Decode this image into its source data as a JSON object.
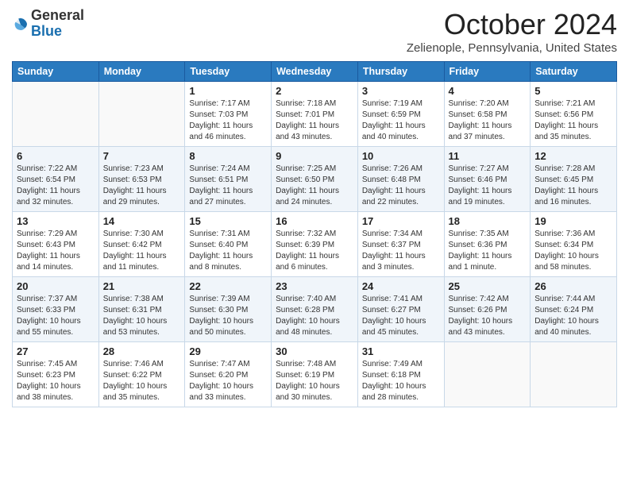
{
  "logo": {
    "general": "General",
    "blue": "Blue"
  },
  "header": {
    "month": "October 2024",
    "location": "Zelienople, Pennsylvania, United States"
  },
  "days_of_week": [
    "Sunday",
    "Monday",
    "Tuesday",
    "Wednesday",
    "Thursday",
    "Friday",
    "Saturday"
  ],
  "weeks": [
    [
      {
        "day": "",
        "info": ""
      },
      {
        "day": "",
        "info": ""
      },
      {
        "day": "1",
        "info": "Sunrise: 7:17 AM\nSunset: 7:03 PM\nDaylight: 11 hours and 46 minutes."
      },
      {
        "day": "2",
        "info": "Sunrise: 7:18 AM\nSunset: 7:01 PM\nDaylight: 11 hours and 43 minutes."
      },
      {
        "day": "3",
        "info": "Sunrise: 7:19 AM\nSunset: 6:59 PM\nDaylight: 11 hours and 40 minutes."
      },
      {
        "day": "4",
        "info": "Sunrise: 7:20 AM\nSunset: 6:58 PM\nDaylight: 11 hours and 37 minutes."
      },
      {
        "day": "5",
        "info": "Sunrise: 7:21 AM\nSunset: 6:56 PM\nDaylight: 11 hours and 35 minutes."
      }
    ],
    [
      {
        "day": "6",
        "info": "Sunrise: 7:22 AM\nSunset: 6:54 PM\nDaylight: 11 hours and 32 minutes."
      },
      {
        "day": "7",
        "info": "Sunrise: 7:23 AM\nSunset: 6:53 PM\nDaylight: 11 hours and 29 minutes."
      },
      {
        "day": "8",
        "info": "Sunrise: 7:24 AM\nSunset: 6:51 PM\nDaylight: 11 hours and 27 minutes."
      },
      {
        "day": "9",
        "info": "Sunrise: 7:25 AM\nSunset: 6:50 PM\nDaylight: 11 hours and 24 minutes."
      },
      {
        "day": "10",
        "info": "Sunrise: 7:26 AM\nSunset: 6:48 PM\nDaylight: 11 hours and 22 minutes."
      },
      {
        "day": "11",
        "info": "Sunrise: 7:27 AM\nSunset: 6:46 PM\nDaylight: 11 hours and 19 minutes."
      },
      {
        "day": "12",
        "info": "Sunrise: 7:28 AM\nSunset: 6:45 PM\nDaylight: 11 hours and 16 minutes."
      }
    ],
    [
      {
        "day": "13",
        "info": "Sunrise: 7:29 AM\nSunset: 6:43 PM\nDaylight: 11 hours and 14 minutes."
      },
      {
        "day": "14",
        "info": "Sunrise: 7:30 AM\nSunset: 6:42 PM\nDaylight: 11 hours and 11 minutes."
      },
      {
        "day": "15",
        "info": "Sunrise: 7:31 AM\nSunset: 6:40 PM\nDaylight: 11 hours and 8 minutes."
      },
      {
        "day": "16",
        "info": "Sunrise: 7:32 AM\nSunset: 6:39 PM\nDaylight: 11 hours and 6 minutes."
      },
      {
        "day": "17",
        "info": "Sunrise: 7:34 AM\nSunset: 6:37 PM\nDaylight: 11 hours and 3 minutes."
      },
      {
        "day": "18",
        "info": "Sunrise: 7:35 AM\nSunset: 6:36 PM\nDaylight: 11 hours and 1 minute."
      },
      {
        "day": "19",
        "info": "Sunrise: 7:36 AM\nSunset: 6:34 PM\nDaylight: 10 hours and 58 minutes."
      }
    ],
    [
      {
        "day": "20",
        "info": "Sunrise: 7:37 AM\nSunset: 6:33 PM\nDaylight: 10 hours and 55 minutes."
      },
      {
        "day": "21",
        "info": "Sunrise: 7:38 AM\nSunset: 6:31 PM\nDaylight: 10 hours and 53 minutes."
      },
      {
        "day": "22",
        "info": "Sunrise: 7:39 AM\nSunset: 6:30 PM\nDaylight: 10 hours and 50 minutes."
      },
      {
        "day": "23",
        "info": "Sunrise: 7:40 AM\nSunset: 6:28 PM\nDaylight: 10 hours and 48 minutes."
      },
      {
        "day": "24",
        "info": "Sunrise: 7:41 AM\nSunset: 6:27 PM\nDaylight: 10 hours and 45 minutes."
      },
      {
        "day": "25",
        "info": "Sunrise: 7:42 AM\nSunset: 6:26 PM\nDaylight: 10 hours and 43 minutes."
      },
      {
        "day": "26",
        "info": "Sunrise: 7:44 AM\nSunset: 6:24 PM\nDaylight: 10 hours and 40 minutes."
      }
    ],
    [
      {
        "day": "27",
        "info": "Sunrise: 7:45 AM\nSunset: 6:23 PM\nDaylight: 10 hours and 38 minutes."
      },
      {
        "day": "28",
        "info": "Sunrise: 7:46 AM\nSunset: 6:22 PM\nDaylight: 10 hours and 35 minutes."
      },
      {
        "day": "29",
        "info": "Sunrise: 7:47 AM\nSunset: 6:20 PM\nDaylight: 10 hours and 33 minutes."
      },
      {
        "day": "30",
        "info": "Sunrise: 7:48 AM\nSunset: 6:19 PM\nDaylight: 10 hours and 30 minutes."
      },
      {
        "day": "31",
        "info": "Sunrise: 7:49 AM\nSunset: 6:18 PM\nDaylight: 10 hours and 28 minutes."
      },
      {
        "day": "",
        "info": ""
      },
      {
        "day": "",
        "info": ""
      }
    ]
  ]
}
